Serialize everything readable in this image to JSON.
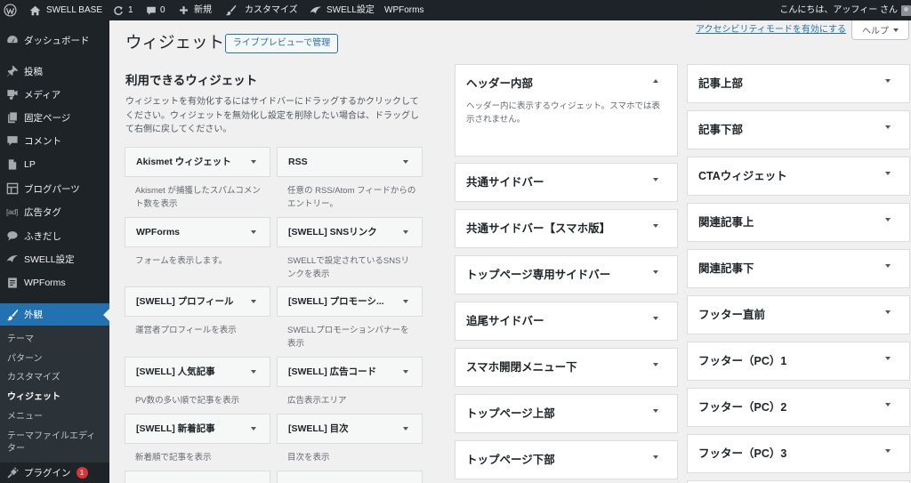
{
  "theme": {
    "accent": "#2271b1",
    "admin_bar_bg": "#1d2327",
    "submenu_bg": "#2c3338",
    "content_bg": "#f0f0f1",
    "badge": "#d63638"
  },
  "admin_bar": {
    "site_name": "SWELL BASE",
    "updates_count": "1",
    "comments_count": "0",
    "new_label": "新規",
    "customize_label": "カスタマイズ",
    "swell_settings_label": "SWELL設定",
    "wpforms_label": "WPForms",
    "greeting": "こんにちは、アッフィー さん"
  },
  "menu": {
    "items": [
      {
        "label": "ダッシュボード",
        "icon": "dashboard-icon"
      },
      {
        "label": "投稿",
        "icon": "pushpin-icon"
      },
      {
        "label": "メディア",
        "icon": "media-icon"
      },
      {
        "label": "固定ページ",
        "icon": "page-icon"
      },
      {
        "label": "コメント",
        "icon": "comment-icon"
      },
      {
        "label": "LP",
        "icon": "lp-page-icon"
      },
      {
        "label": "ブログパーツ",
        "icon": "blog-parts-icon"
      },
      {
        "label": "広告タグ",
        "icon": "ad-icon",
        "icon_text": "[ad]"
      },
      {
        "label": "ふきだし",
        "icon": "speech-bubble-icon"
      },
      {
        "label": "SWELL設定",
        "icon": "swell-icon"
      },
      {
        "label": "WPForms",
        "icon": "wpforms-icon"
      }
    ],
    "appearance": {
      "label": "外観",
      "icon": "paintbrush-icon",
      "submenu": [
        {
          "label": "テーマ"
        },
        {
          "label": "パターン"
        },
        {
          "label": "カスタマイズ"
        },
        {
          "label": "ウィジェット",
          "current": true
        },
        {
          "label": "メニュー"
        },
        {
          "label": "テーマファイルエディター"
        }
      ]
    },
    "plugins": {
      "label": "プラグイン",
      "icon": "plugin-icon",
      "badge": "1"
    }
  },
  "page": {
    "title": "ウィジェット",
    "live_preview_button": "ライブプレビューで管理",
    "accessibility_link": "アクセシビリティモードを有効にする",
    "help_button": "ヘルプ"
  },
  "available_widgets": {
    "heading": "利用できるウィジェット",
    "description": "ウィジェットを有効化するにはサイドバーにドラッグするかクリックしてください。ウィジェットを無効化し設定を削除したい場合は、ドラッグして右側に戻してください。",
    "widgets": [
      {
        "title": "Akismet ウィジェット",
        "description": "Akismet が捕獲したスパムコメント数を表示"
      },
      {
        "title": "RSS",
        "description": "任意の RSS/Atom フィードからのエントリー。"
      },
      {
        "title": "WPForms",
        "description": "フォームを表示します。"
      },
      {
        "title": "[SWELL] SNSリンク",
        "description": "SWELLで設定されているSNSリンクを表示"
      },
      {
        "title": "[SWELL] プロフィール",
        "description": "運営者プロフィールを表示"
      },
      {
        "title": "[SWELL] プロモーシ...",
        "description": "SWELLプロモーションバナーを表示"
      },
      {
        "title": "[SWELL] 人気記事",
        "description": "PV数の多い順で記事を表示"
      },
      {
        "title": "[SWELL] 広告コード",
        "description": "広告表示エリア"
      },
      {
        "title": "[SWELL] 新着記事",
        "description": "新着順で記事を表示"
      },
      {
        "title": "[SWELL] 目次",
        "description": "目次を表示"
      }
    ]
  },
  "widget_areas": {
    "column_1": [
      {
        "title": "ヘッダー内部",
        "expanded": true,
        "description": "ヘッダー内に表示するウィジェット。スマホでは表示されません。"
      },
      {
        "title": "共通サイドバー"
      },
      {
        "title": "共通サイドバー【スマホ版】"
      },
      {
        "title": "トップページ専用サイドバー"
      },
      {
        "title": "追尾サイドバー"
      },
      {
        "title": "スマホ開閉メニュー下"
      },
      {
        "title": "トップページ上部"
      },
      {
        "title": "トップページ下部"
      }
    ],
    "column_2": [
      {
        "title": "記事上部"
      },
      {
        "title": "記事下部"
      },
      {
        "title": "CTAウィジェット"
      },
      {
        "title": "関連記事上"
      },
      {
        "title": "関連記事下"
      },
      {
        "title": "フッター直前"
      },
      {
        "title": "フッター（PC）1"
      },
      {
        "title": "フッター（PC）2"
      },
      {
        "title": "フッター（PC）3"
      }
    ]
  }
}
